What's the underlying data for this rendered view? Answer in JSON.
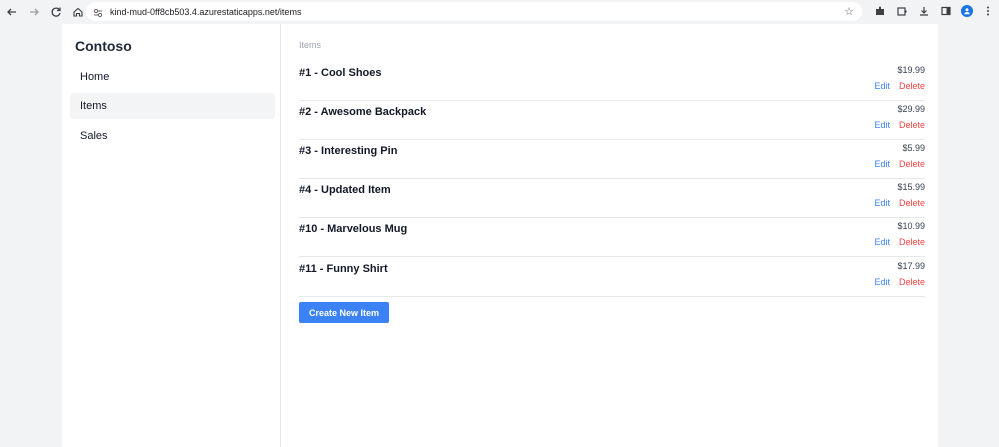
{
  "browser": {
    "url": "kind-mud-0ff8cb503.4.azurestaticapps.net/items",
    "icons": [
      "back-arrow-icon",
      "forward-arrow-icon",
      "reload-icon",
      "home-icon",
      "site-info-icon",
      "bookmark-star-icon",
      "extension-icon",
      "puzzle-icon",
      "download-icon",
      "side-panel-icon",
      "profile-icon",
      "menu-dots-icon"
    ]
  },
  "sidebar": {
    "brand": "Contoso",
    "items": [
      {
        "label": "Home",
        "active": false
      },
      {
        "label": "Items",
        "active": true
      },
      {
        "label": "Sales",
        "active": false
      }
    ]
  },
  "main": {
    "breadcrumb": "Items",
    "edit_label": "Edit",
    "delete_label": "Delete",
    "items": [
      {
        "title": "#1 - Cool Shoes",
        "price": "$19.99"
      },
      {
        "title": "#2 - Awesome Backpack",
        "price": "$29.99"
      },
      {
        "title": "#3 - Interesting Pin",
        "price": "$5.99"
      },
      {
        "title": "#4 - Updated Item",
        "price": "$15.99"
      },
      {
        "title": "#10 - Marvelous Mug",
        "price": "$10.99"
      },
      {
        "title": "#11 - Funny Shirt",
        "price": "$17.99"
      }
    ],
    "create_label": "Create New Item"
  },
  "colors": {
    "accent": "#3b82f6",
    "danger": "#ef4444",
    "active_bg": "#f3f4f6"
  }
}
